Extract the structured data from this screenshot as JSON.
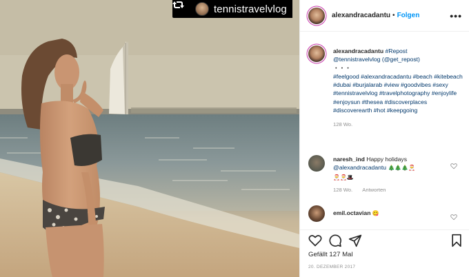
{
  "repost_tag": {
    "username": "tennistravelvlog",
    "icon": "repost-icon"
  },
  "header": {
    "username": "alexandracadantu",
    "separator": "•",
    "follow_label": "Folgen",
    "more": "•••"
  },
  "caption": {
    "username": "alexandracadantu",
    "hashtag_repost": "#Repost",
    "mention_1": "@tennistravelvlog",
    "mention_2": "(@get_repost)",
    "dots": "・・・",
    "hashtags": "#feelgood #alexandracadantu #beach #kitebeach #dubai #burjalarab #view #goodvibes #sexy #tennistravelvlog #travelphotography #enjoylife #enjoysun #thesea #discoverplaces #discoverearth #hot #keepgoing",
    "age": "128 Wo."
  },
  "comment_1": {
    "username": "naresh_ind",
    "text": "Happy holidays",
    "mention": "@alexandracadantu",
    "emoji_line_1": "🎄🎄🎄🎅",
    "emoji_line_2": "🎅🎅🎩",
    "age": "128 Wo.",
    "reply_label": "Antworten"
  },
  "comment_2": {
    "username": "emil.octavian",
    "emoji": "😋"
  },
  "actions": {
    "likes": "Gefällt 127 Mal",
    "date": "20. DEZEMBER 2017"
  }
}
